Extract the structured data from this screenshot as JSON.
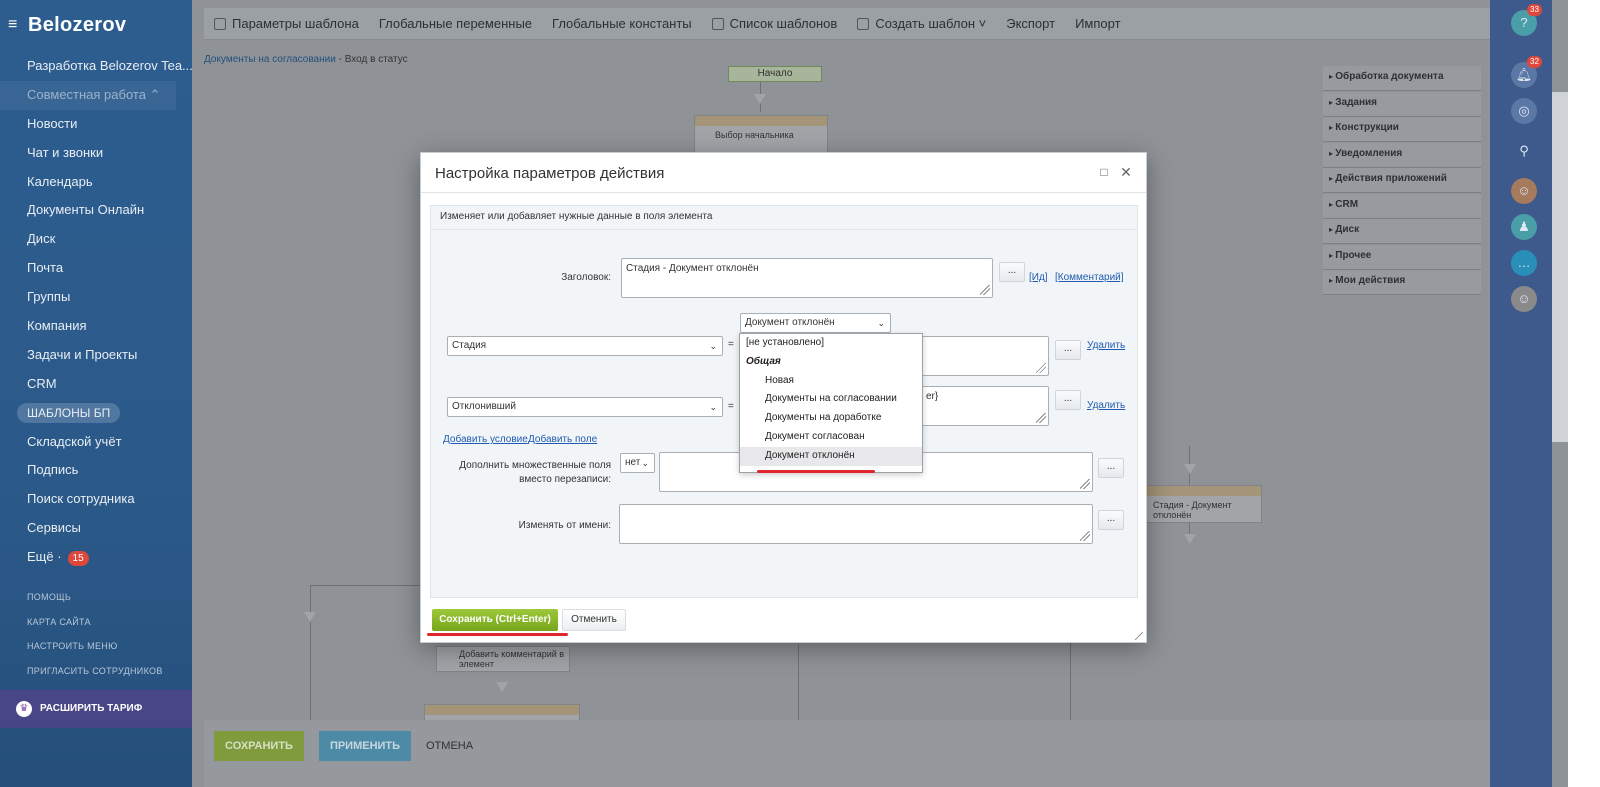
{
  "sidebar": {
    "logo": "Belozerov",
    "items": [
      {
        "label": "Разработка Belozerov Tea..."
      },
      {
        "label": "Совместная работа ⌃"
      },
      {
        "label": "Новости"
      },
      {
        "label": "Чат и звонки"
      },
      {
        "label": "Календарь"
      },
      {
        "label": "Документы Онлайн"
      },
      {
        "label": "Диск"
      },
      {
        "label": "Почта"
      },
      {
        "label": "Группы"
      },
      {
        "label": "Компания"
      },
      {
        "label": "Задачи и Проекты"
      },
      {
        "label": "CRM"
      },
      {
        "label": "ШАБЛОНЫ БП"
      },
      {
        "label": "Складской учёт"
      },
      {
        "label": "Подпись"
      },
      {
        "label": "Поиск сотрудника"
      },
      {
        "label": "Сервисы"
      },
      {
        "label": "Ещё ·",
        "counter": "15"
      }
    ],
    "small_links": [
      "ПОМОЩЬ",
      "КАРТА САЙТА",
      "НАСТРОИТЬ МЕНЮ",
      "ПРИГЛАСИТЬ СОТРУДНИКОВ"
    ],
    "upgrade": "РАСШИРИТЬ ТАРИФ"
  },
  "toolbar": {
    "items": [
      "Параметры шаблона",
      "Глобальные переменные",
      "Глобальные константы",
      "Список шаблонов",
      "Создать шаблон ˅",
      "Экспорт",
      "Импорт"
    ]
  },
  "breadcrumb": {
    "link": "Документы на согласовании",
    "current": " - Вход в статус"
  },
  "canvas": {
    "start": "Начало",
    "block1": "Выбор начальника",
    "block2": "Стадия - Документ отклонён",
    "block3": "Добавить комментарий в элемент"
  },
  "right_panel": {
    "items": [
      "Обработка документа",
      "Задания",
      "Конструкции",
      "Уведомления",
      "Действия приложений",
      "CRM",
      "Диск",
      "Прочее",
      "Мои действия"
    ]
  },
  "bottom": {
    "save": "СОХРАНИТЬ",
    "apply": "ПРИМЕНИТЬ",
    "cancel": "ОТМЕНА"
  },
  "rail": {
    "badge_top": "33",
    "badge_bell": "32"
  },
  "dialog": {
    "title": "Настройка параметров действия",
    "description": "Изменяет или добавляет нужные данные в поля элемента",
    "heading_label": "Заголовок:",
    "heading_value": "Стадия - Документ отклонён",
    "dots": "...",
    "link_id": "[Ид]",
    "link_comment": "[Комментарий]",
    "field1_select": "Стадия",
    "field1_value": "Документ отклонён",
    "field2_select": "Отклонивший",
    "field2_partial": "er}",
    "eq": "=",
    "delete": "Удалить",
    "add_condition": "Добавить условие",
    "add_field": "Добавить поле",
    "multi_label_1": "Дополнить множественные поля",
    "multi_label_2": "вместо перезаписи:",
    "multi_select": "нет",
    "change_from_label": "Изменять от имени:",
    "dropdown": {
      "options": [
        "[не установлено]",
        "Общая",
        "Новая",
        "Документы на согласовании",
        "Документы на доработке",
        "Документ согласован",
        "Документ отклонён"
      ],
      "selected": "Документ отклонён"
    },
    "save_button": "Сохранить (Ctrl+Enter)",
    "cancel_button": "Отменить"
  },
  "colors": {
    "sidebar": "#2d5d8f",
    "save_green": "#76a51b",
    "link_blue": "#1f5bb0",
    "highlight_red": "#e0262b"
  }
}
